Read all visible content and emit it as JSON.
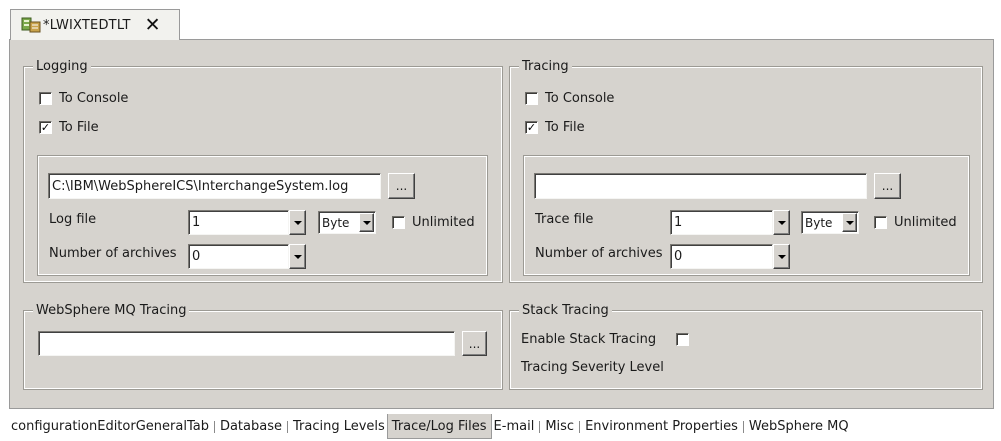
{
  "editor_tab": {
    "title": "*LWIXTEDTLT",
    "close": "✕",
    "icon": "server-config-icon"
  },
  "logging": {
    "legend": "Logging",
    "to_console_label": "To Console",
    "to_console_checked": false,
    "to_file_label": "To File",
    "to_file_checked": true,
    "file_path": "C:\\IBM\\WebSphereICS\\InterchangeSystem.log",
    "browse_label": "...",
    "log_file_label": "Log file",
    "log_file_size": "1",
    "unit": "Byte",
    "unlimited_label": "Unlimited",
    "unlimited_checked": false,
    "archives_label": "Number of archives",
    "archives_value": "0"
  },
  "tracing": {
    "legend": "Tracing",
    "to_console_label": "To Console",
    "to_console_checked": false,
    "to_file_label": "To File",
    "to_file_checked": true,
    "file_path": "",
    "browse_label": "...",
    "trace_file_label": "Trace file",
    "trace_file_size": "1",
    "unit": "Byte",
    "unlimited_label": "Unlimited",
    "unlimited_checked": false,
    "archives_label": "Number of archives",
    "archives_value": "0"
  },
  "mq_tracing": {
    "legend": "WebSphere MQ Tracing",
    "path": "",
    "browse_label": "..."
  },
  "stack_tracing": {
    "legend": "Stack Tracing",
    "enable_label": "Enable Stack Tracing",
    "enable_checked": false,
    "severity_label": "Tracing Severity Level"
  },
  "bottom_tabs": [
    {
      "label": "configurationEditorGeneralTab",
      "active": false
    },
    {
      "label": "Database",
      "active": false
    },
    {
      "label": "Tracing Levels",
      "active": false
    },
    {
      "label": "Trace/Log Files",
      "active": true
    },
    {
      "label": "E-mail",
      "active": false
    },
    {
      "label": "Misc",
      "active": false
    },
    {
      "label": "Environment Properties",
      "active": false
    },
    {
      "label": "WebSphere MQ",
      "active": false
    }
  ],
  "colors": {
    "panel": "#d6d3ce",
    "field": "#ffffff",
    "tab_bg": "#f2f2ee"
  }
}
